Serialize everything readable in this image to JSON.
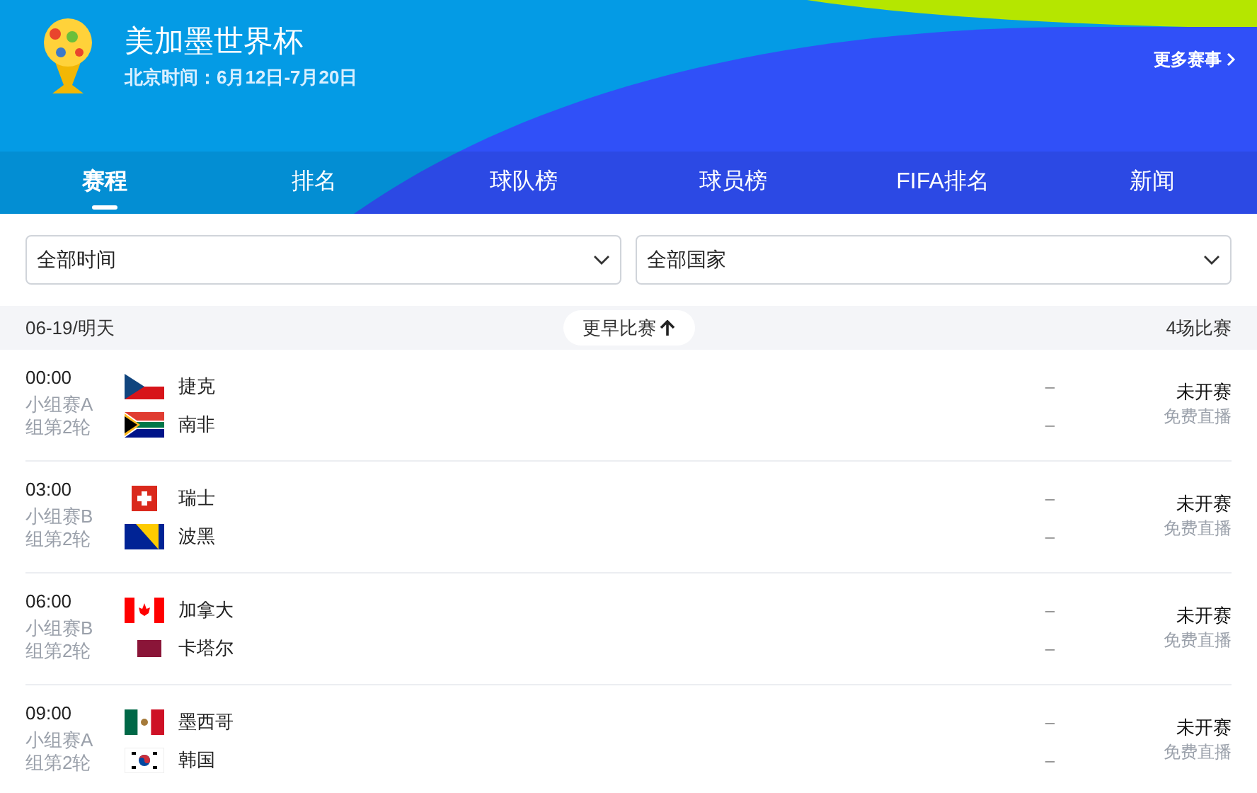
{
  "header": {
    "title": "美加墨世界杯",
    "subtitle": "北京时间：6月12日-7月20日",
    "more_link": "更多赛事"
  },
  "tabs": [
    {
      "label": "赛程",
      "selected": true
    },
    {
      "label": "排名",
      "selected": false
    },
    {
      "label": "球队榜",
      "selected": false
    },
    {
      "label": "球员榜",
      "selected": false
    },
    {
      "label": "FIFA排名",
      "selected": false
    },
    {
      "label": "新闻",
      "selected": false
    }
  ],
  "filters": [
    {
      "value": "全部时间"
    },
    {
      "value": "全部国家"
    }
  ],
  "date_bar": {
    "date": "06-19/明天",
    "earlier_button": "更早比赛",
    "count": "4场比赛"
  },
  "matches": [
    {
      "time": "00:00",
      "stage": "小组赛A组第2轮",
      "status": "未开赛",
      "broadcast": "免费直播",
      "teams": [
        {
          "name": "捷克",
          "kind": "cz",
          "score": "–"
        },
        {
          "name": "南非",
          "kind": "za",
          "score": "–"
        }
      ]
    },
    {
      "time": "03:00",
      "stage": "小组赛B组第2轮",
      "status": "未开赛",
      "broadcast": "免费直播",
      "teams": [
        {
          "name": "瑞士",
          "kind": "ch",
          "score": "–"
        },
        {
          "name": "波黑",
          "kind": "ba",
          "score": "–"
        }
      ]
    },
    {
      "time": "06:00",
      "stage": "小组赛B组第2轮",
      "status": "未开赛",
      "broadcast": "免费直播",
      "teams": [
        {
          "name": "加拿大",
          "kind": "ca",
          "score": "–"
        },
        {
          "name": "卡塔尔",
          "kind": "qa",
          "score": "–"
        }
      ]
    },
    {
      "time": "09:00",
      "stage": "小组赛A组第2轮",
      "status": "未开赛",
      "broadcast": "免费直播",
      "teams": [
        {
          "name": "墨西哥",
          "kind": "mx",
          "score": "–"
        },
        {
          "name": "韩国",
          "kind": "kr",
          "score": "–"
        }
      ]
    }
  ]
}
